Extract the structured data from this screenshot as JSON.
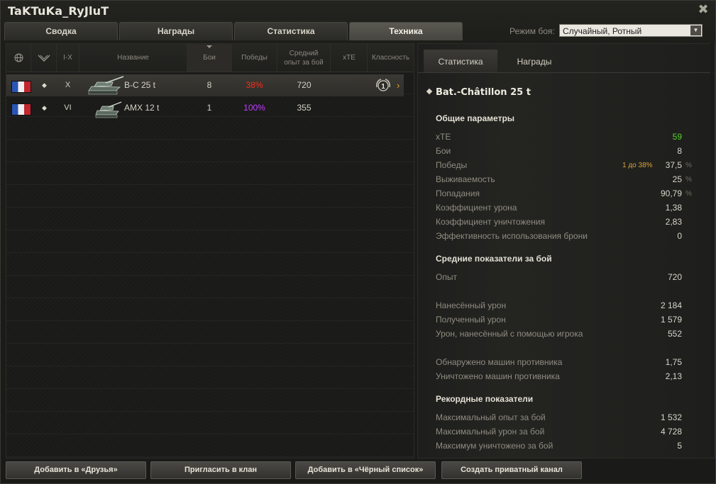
{
  "window": {
    "title": "TaKTuKa_RyJluT",
    "close_glyph": "✖"
  },
  "tabs": [
    {
      "label": "Сводка"
    },
    {
      "label": "Награды"
    },
    {
      "label": "Статистика"
    },
    {
      "label": "Техника",
      "active": true
    }
  ],
  "battle_mode": {
    "label": "Режим боя:",
    "value": "Случайный, Ротный"
  },
  "vehicle_table": {
    "columns": {
      "nation": "nation-globe-icon",
      "type": "vehicle-type-icon",
      "tier": "I-X",
      "name": "Название",
      "battles": "Бои",
      "wins": "Победы",
      "avg_exp": "Средний опыт за бой",
      "xte": "xTE",
      "mastery": "Классность"
    },
    "rows": [
      {
        "nation": "france",
        "tier": "X",
        "name": "B-C 25 t",
        "battles": "8",
        "wins": "38%",
        "wins_color": "#ff2a1a",
        "avg_exp": "720",
        "xte": "",
        "mastery": "1",
        "selected": true
      },
      {
        "nation": "france",
        "tier": "VI",
        "name": "AMX 12 t",
        "battles": "1",
        "wins": "100%",
        "wins_color": "#c03cff",
        "avg_exp": "355",
        "xte": "",
        "mastery": "",
        "selected": false
      }
    ]
  },
  "details": {
    "tabs": [
      {
        "label": "Статистика",
        "active": true
      },
      {
        "label": "Награды"
      }
    ],
    "vehicle_name": "Bat.-Châtillon 25 t",
    "general": {
      "heading": "Общие параметры",
      "items": [
        {
          "label": "xTE",
          "value": "59",
          "unit": ""
        },
        {
          "label": "Бои",
          "value": "8",
          "unit": ""
        },
        {
          "label": "Победы",
          "value": "37,5",
          "unit": "%",
          "extra": "1 до 38%"
        },
        {
          "label": "Выживаемость",
          "value": "25",
          "unit": "%"
        },
        {
          "label": "Попадания",
          "value": "90,79",
          "unit": "%"
        },
        {
          "label": "Коэффициент урона",
          "value": "1,38",
          "unit": ""
        },
        {
          "label": "Коэффициент уничтожения",
          "value": "2,83",
          "unit": ""
        },
        {
          "label": "Эффективность использования брони",
          "value": "0",
          "unit": ""
        }
      ]
    },
    "average": {
      "heading": "Средние показатели за бой",
      "items": [
        {
          "label": "Опыт",
          "value": "720"
        },
        {
          "label": "Нанесённый урон",
          "value": "2 184"
        },
        {
          "label": "Полученный урон",
          "value": "1 579"
        },
        {
          "label": "Урон, нанесённый с помощью игрока",
          "value": "552"
        },
        {
          "label": "Обнаружено машин противника",
          "value": "1,75"
        },
        {
          "label": "Уничтожено машин противника",
          "value": "2,13"
        }
      ]
    },
    "records": {
      "heading": "Рекордные показатели",
      "items": [
        {
          "label": "Максимальный опыт за бой",
          "value": "1 532"
        },
        {
          "label": "Максимальный урон за бой",
          "value": "4 728"
        },
        {
          "label": "Максимум уничтожено за бой",
          "value": "5"
        }
      ]
    }
  },
  "buttons": [
    {
      "label": "Добавить в «Друзья»"
    },
    {
      "label": "Пригласить в клан"
    },
    {
      "label": "Добавить в «Чёрный список»"
    },
    {
      "label": "Создать приватный канал"
    }
  ],
  "colors": {
    "xte_green": "#56d42a",
    "selected_arrow": "#e0a020"
  }
}
